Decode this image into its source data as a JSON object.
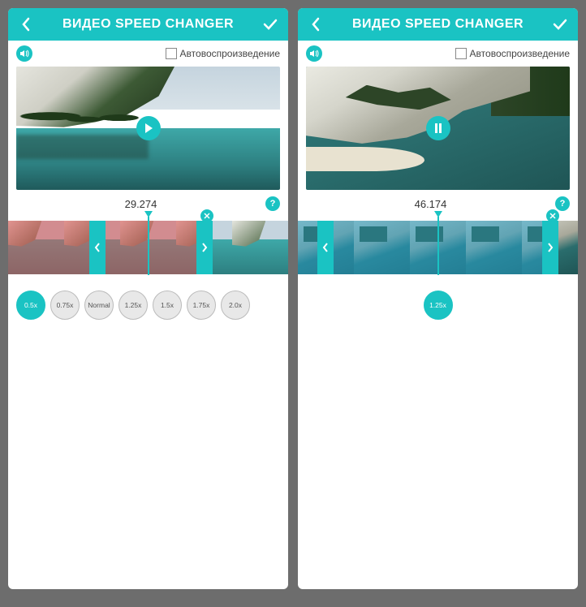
{
  "app": {
    "title": "ВИДЕО SPEED CHANGER",
    "autoplay_label": "Автовоспроизведение",
    "help_glyph": "?"
  },
  "icons": {
    "back": "chevron-left",
    "confirm": "check",
    "sound": "speaker",
    "play": "play",
    "pause": "pause",
    "close": "x"
  },
  "colors": {
    "accent": "#1ac3c3",
    "tint_red": "rgba(220,80,80,0.55)",
    "tint_blue": "rgba(40,160,200,0.55)"
  },
  "left": {
    "time": "29.274",
    "autoplay_checked": false,
    "center_icon": "play",
    "close_badge_pos_pct": 71,
    "timeline": {
      "tint": "red",
      "tint_left_pct": 0,
      "tint_width_pct": 70,
      "selection_left_pct": 29,
      "selection_width_pct": 44
    },
    "speed_buttons": [
      {
        "label": "0.5x",
        "active": true
      },
      {
        "label": "0.75x",
        "active": false
      },
      {
        "label": "Normal",
        "active": false
      },
      {
        "label": "1.25x",
        "active": false
      },
      {
        "label": "1.5x",
        "active": false
      },
      {
        "label": "1.75x",
        "active": false
      },
      {
        "label": "2.0x",
        "active": false
      }
    ]
  },
  "right": {
    "time": "46.174",
    "autoplay_checked": false,
    "center_icon": "pause",
    "close_badge_pos_pct": 91,
    "timeline": {
      "tint": "blue",
      "tint_left_pct": 0,
      "tint_width_pct": 92,
      "selection_left_pct": 7,
      "selection_width_pct": 86
    },
    "speed_buttons": [
      {
        "label": "1.25x",
        "active": true
      }
    ]
  }
}
